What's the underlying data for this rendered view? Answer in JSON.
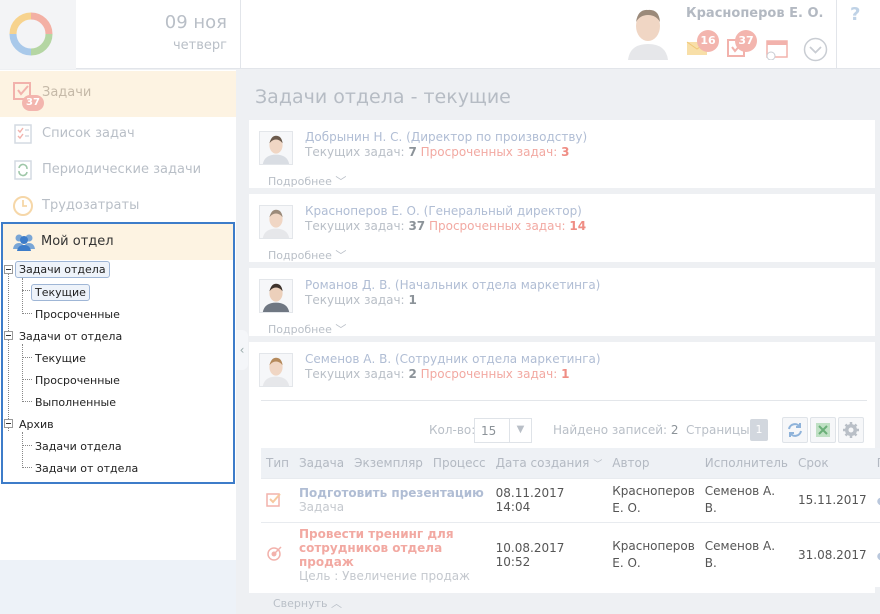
{
  "header": {
    "date_day": "09 ноя",
    "date_weekday": "четверг",
    "user_name": "Красноперов Е. О.",
    "mail_count": "16",
    "tasks_count": "37",
    "help": "?"
  },
  "sidebar": {
    "items": [
      {
        "label": "Задачи",
        "badge": "37"
      },
      {
        "label": "Список задач"
      },
      {
        "label": "Периодические задачи"
      },
      {
        "label": "Трудозатраты"
      }
    ],
    "department": {
      "label": "Мой отдел",
      "tree": {
        "dept_tasks": "Задачи отдела",
        "dept_current": "Текущие",
        "dept_overdue": "Просроченные",
        "from_dept": "Задачи от отдела",
        "from_current": "Текущие",
        "from_overdue": "Просроченные",
        "from_done": "Выполненные",
        "archive": "Архив",
        "archive_dept": "Задачи отдела",
        "archive_from": "Задачи от отдела"
      }
    }
  },
  "main": {
    "title": "Задачи отдела - текущие",
    "more_label": "Подробнее",
    "collapse_label": "Свернуть",
    "current_label": "Текущих задач:",
    "overdue_label": "Просроченных задач:",
    "employees": [
      {
        "name": "Добрынин Н. С. (Директор по производству)",
        "current": "7",
        "overdue": "3"
      },
      {
        "name": "Красноперов Е. О. (Генеральный директор)",
        "current": "37",
        "overdue": "14"
      },
      {
        "name": "Романов Д. В. (Начальник отдела маркетинга)",
        "current": "1"
      },
      {
        "name": "Семенов А. В. (Сотрудник отдела маркетинга)",
        "current": "2",
        "overdue": "1"
      }
    ],
    "toolbar": {
      "count_label": "Кол-во:",
      "count_value": "15",
      "found_label": "Найдено записей:",
      "found_value": "2",
      "pages_label": "Страницы:",
      "page": "1"
    },
    "table": {
      "headers": [
        "Тип",
        "Задача",
        "Экземпляр",
        "Процесс",
        "Дата создания",
        "Автор",
        "Исполнитель",
        "Срок",
        "Пр."
      ],
      "rows": [
        {
          "title": "Подготовить презентацию",
          "sub": "Задача",
          "created": "08.11.2017 14:04",
          "author": "Красноперов Е. О.",
          "executor": "Семенов А. В.",
          "deadline": "15.11.2017"
        },
        {
          "title": "Провести тренинг для сотрудников отдела продаж",
          "sub": "Цель : Увеличение продаж",
          "created": "10.08.2017 10:52",
          "author": "Красноперов Е. О.",
          "executor": "Семенов А. В.",
          "deadline": "31.08.2017"
        }
      ]
    }
  }
}
